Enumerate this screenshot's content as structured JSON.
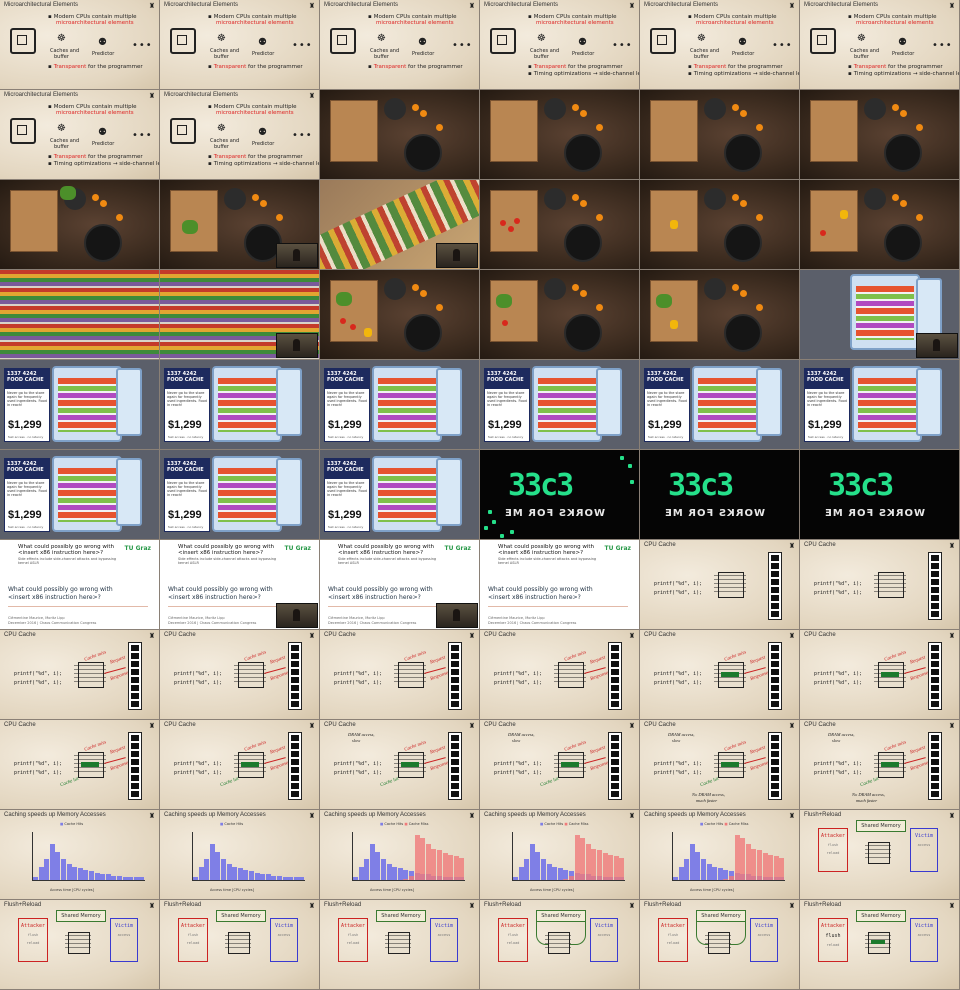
{
  "micro": {
    "title": "Microarchitectural Elements",
    "bullet1_line1": "Modern CPUs contain multiple",
    "bullet1_line2": "microarchitectural elements",
    "caches": "Caches and",
    "buffer": "buffer",
    "predictor": "Predictor",
    "ellipsis": "•••",
    "transparent": "Transparent",
    "for_programmer": "for the programmer",
    "timing": "Timing optimizations → side-channel leakage"
  },
  "ad": {
    "code": "1337 4242",
    "name": "FOOD CACHE",
    "tagline": "Store your food at home in a tiny cache",
    "body": "Never go to the store again for frequently used ingredients. Food in reach!",
    "price": "$1,299",
    "foot": "fast access · no latency"
  },
  "c3": {
    "logo": "33c3",
    "sub": "WORKS FOR ME"
  },
  "talk": {
    "question": "What could possibly go wrong with <insert x86 instruction here>?",
    "subtitle": "Side effects include side-channel attacks and bypassing kernel ASLR",
    "logo": "TU Graz",
    "main_line1": "What could possibly go wrong with",
    "main_line2": "<insert x86 instruction here>?",
    "foot_line1": "Clémentine Maurice, Moritz Lipp",
    "foot_line2": "December 2016 | Chaos Communication Congress"
  },
  "cache": {
    "title": "CPU Cache",
    "code1": "printf(\"%d\", i);",
    "code2": "printf(\"%d\", i);",
    "miss": "Cache miss",
    "hit": "Cache hit",
    "request": "Request",
    "response": "Response",
    "dram_access": "DRAM access,",
    "slow": "slow",
    "no_dram": "No DRAM access,",
    "faster": "much faster"
  },
  "hist": {
    "title": "Caching speeds up Memory Accesses",
    "legend_miss": "Cache Miss",
    "legend_hit": "Cache Hits",
    "xlabel": "Access time [CPU cycles]"
  },
  "chart_data": {
    "type": "bar",
    "title": "Caching speeds up Memory Accesses",
    "xlabel": "Access time [CPU cycles]",
    "ylabel": "Number of accesses",
    "series": [
      {
        "name": "Cache Hits",
        "color": "#7f7fe6",
        "values": [
          2,
          9,
          14,
          24,
          19,
          14,
          11,
          9,
          8,
          7,
          6,
          5,
          4,
          4,
          3,
          3,
          2,
          2,
          2,
          2
        ]
      },
      {
        "name": "Cache Miss",
        "color": "#f07a7a",
        "values": [
          0,
          0,
          0,
          0,
          0,
          0,
          0,
          0,
          0,
          1,
          3,
          30,
          28,
          24,
          21,
          20,
          18,
          17,
          16,
          15
        ]
      }
    ]
  },
  "flush": {
    "title": "Flush+Reload",
    "shared": "Shared Memory",
    "attacker": "Attacker",
    "victim": "Victim",
    "flush_word": "flush",
    "reload_word": "reload",
    "access_word": "access"
  },
  "colors": {
    "accent_red": "#d22222",
    "accent_green": "#1b7a2c",
    "accent_blue": "#3a3ad0"
  }
}
